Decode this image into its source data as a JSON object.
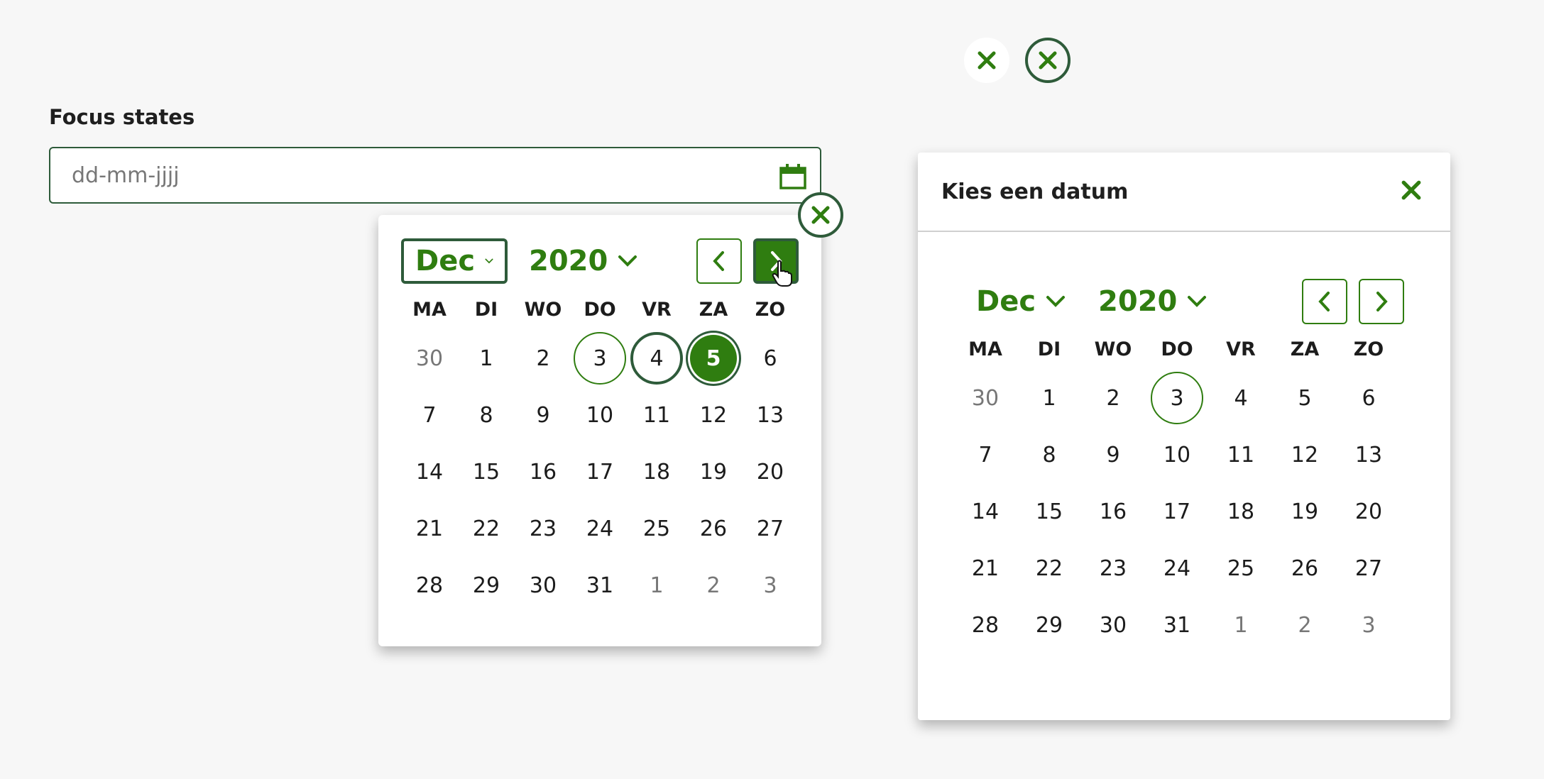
{
  "field": {
    "label": "Focus states",
    "placeholder": "dd-mm-jjjj"
  },
  "weekdays": [
    "MA",
    "DI",
    "WO",
    "DO",
    "VR",
    "ZA",
    "ZO"
  ],
  "popover": {
    "month": "Dec",
    "year": "2020",
    "days": [
      {
        "d": "30",
        "muted": true
      },
      {
        "d": "1"
      },
      {
        "d": "2"
      },
      {
        "d": "3",
        "today": true
      },
      {
        "d": "4",
        "focused": true
      },
      {
        "d": "5",
        "selected": true
      },
      {
        "d": "6"
      },
      {
        "d": "7"
      },
      {
        "d": "8"
      },
      {
        "d": "9"
      },
      {
        "d": "10"
      },
      {
        "d": "11"
      },
      {
        "d": "12"
      },
      {
        "d": "13"
      },
      {
        "d": "14"
      },
      {
        "d": "15"
      },
      {
        "d": "16"
      },
      {
        "d": "17"
      },
      {
        "d": "18"
      },
      {
        "d": "19"
      },
      {
        "d": "20"
      },
      {
        "d": "21"
      },
      {
        "d": "22"
      },
      {
        "d": "23"
      },
      {
        "d": "24"
      },
      {
        "d": "25"
      },
      {
        "d": "26"
      },
      {
        "d": "27"
      },
      {
        "d": "28"
      },
      {
        "d": "29"
      },
      {
        "d": "30"
      },
      {
        "d": "31"
      },
      {
        "d": "1",
        "muted": true
      },
      {
        "d": "2",
        "muted": true
      },
      {
        "d": "3",
        "muted": true
      }
    ]
  },
  "dialog": {
    "title": "Kies een datum",
    "month": "Dec",
    "year": "2020",
    "days": [
      {
        "d": "30",
        "muted": true
      },
      {
        "d": "1"
      },
      {
        "d": "2"
      },
      {
        "d": "3",
        "today": true
      },
      {
        "d": "4"
      },
      {
        "d": "5"
      },
      {
        "d": "6"
      },
      {
        "d": "7"
      },
      {
        "d": "8"
      },
      {
        "d": "9"
      },
      {
        "d": "10"
      },
      {
        "d": "11"
      },
      {
        "d": "12"
      },
      {
        "d": "13"
      },
      {
        "d": "14"
      },
      {
        "d": "15"
      },
      {
        "d": "16"
      },
      {
        "d": "17"
      },
      {
        "d": "18"
      },
      {
        "d": "19"
      },
      {
        "d": "20"
      },
      {
        "d": "21"
      },
      {
        "d": "22"
      },
      {
        "d": "23"
      },
      {
        "d": "24"
      },
      {
        "d": "25"
      },
      {
        "d": "26"
      },
      {
        "d": "27"
      },
      {
        "d": "28"
      },
      {
        "d": "29"
      },
      {
        "d": "30"
      },
      {
        "d": "31"
      },
      {
        "d": "1",
        "muted": true
      },
      {
        "d": "2",
        "muted": true
      },
      {
        "d": "3",
        "muted": true
      }
    ]
  },
  "colors": {
    "accent": "#2f7d10",
    "focus_ring": "#2e5b3a",
    "background": "#f7f7f7"
  },
  "icons": {
    "close": "close-icon",
    "calendar": "calendar-icon",
    "chevron_down": "chevron-down-icon",
    "chevron_left": "chevron-left-icon",
    "chevron_right": "chevron-right-icon",
    "cursor": "pointer-hand-icon"
  }
}
